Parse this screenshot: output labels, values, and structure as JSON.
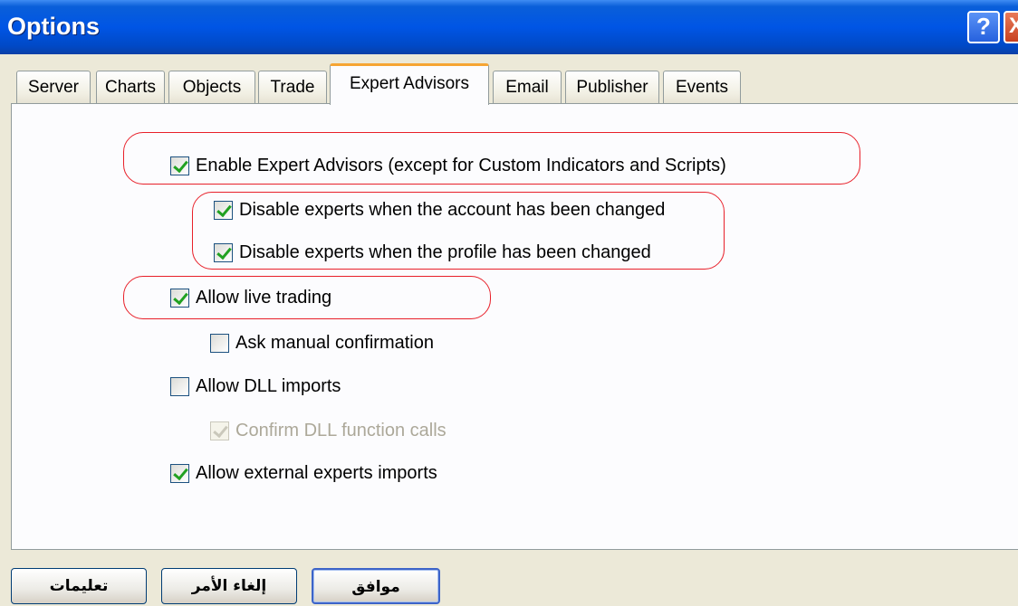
{
  "window": {
    "title": "Options",
    "help_glyph": "?",
    "close_glyph": "X"
  },
  "tabs": [
    {
      "label": "Server"
    },
    {
      "label": "Charts"
    },
    {
      "label": "Objects"
    },
    {
      "label": "Trade"
    },
    {
      "label": "Expert Advisors",
      "active": true
    },
    {
      "label": "Email"
    },
    {
      "label": "Publisher"
    },
    {
      "label": "Events"
    }
  ],
  "options": {
    "enable_experts": {
      "label": "Enable Expert Advisors (except for Custom Indicators and Scripts)",
      "checked": true
    },
    "disable_account": {
      "label": "Disable experts when the account has been changed",
      "checked": true
    },
    "disable_profile": {
      "label": "Disable experts when the profile has been changed",
      "checked": true
    },
    "allow_live": {
      "label": "Allow live trading",
      "checked": true
    },
    "ask_manual": {
      "label": "Ask manual confirmation",
      "checked": false
    },
    "allow_dll": {
      "label": "Allow DLL imports",
      "checked": false
    },
    "confirm_dll": {
      "label": "Confirm DLL function calls",
      "checked": true,
      "disabled": true
    },
    "allow_external": {
      "label": "Allow external experts imports",
      "checked": true
    }
  },
  "buttons": {
    "ok": "موافق",
    "cancel": "إلغاء الأمر",
    "help": "تعليمات"
  },
  "colors": {
    "highlight": "#e8202a",
    "check": "#21a121",
    "titlebar": "#0055e5"
  }
}
